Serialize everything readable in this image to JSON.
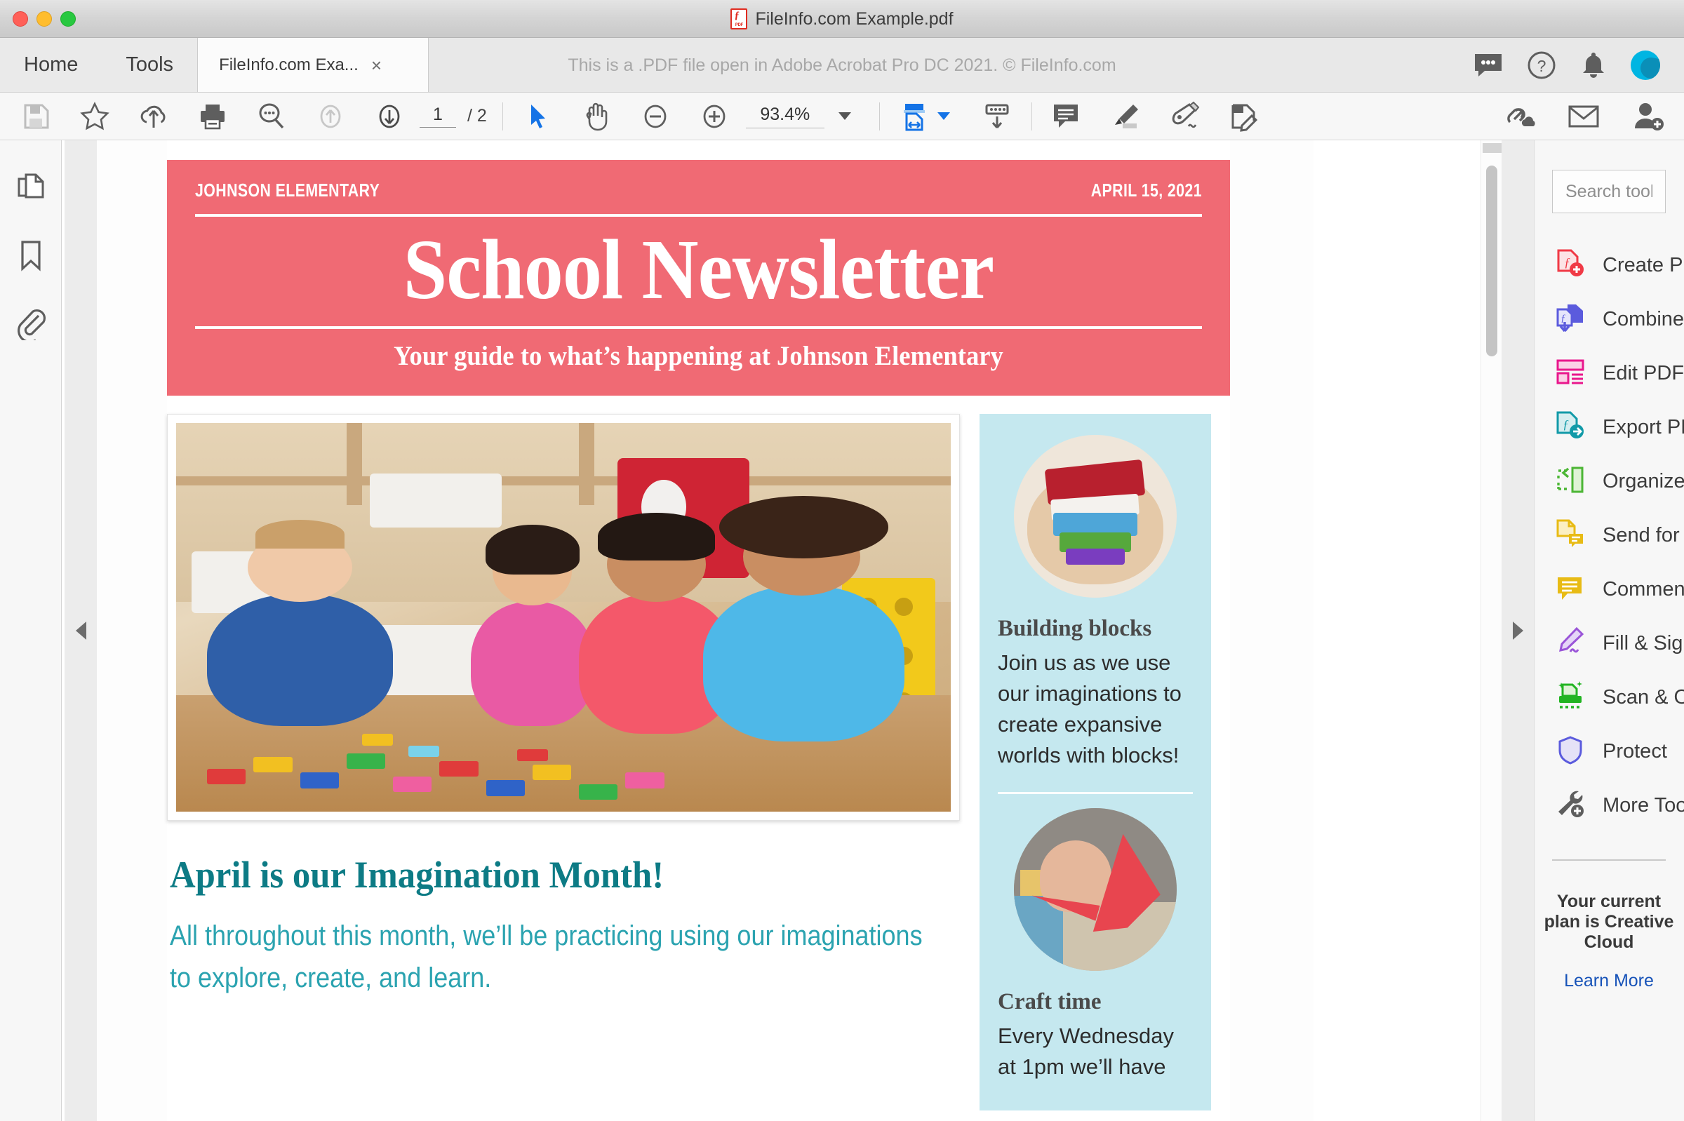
{
  "window": {
    "title": "FileInfo.com Example.pdf",
    "traffic_lights": [
      "close",
      "minimize",
      "zoom"
    ]
  },
  "tabbar": {
    "home_label": "Home",
    "tools_label": "Tools",
    "doc_tab_label": "FileInfo.com Exa...",
    "doc_tab_close": "×",
    "watermark_note": "This is a .PDF file open in Adobe Acrobat Pro DC 2021. © FileInfo.com",
    "right_icons": [
      "chat-icon",
      "help-icon",
      "bell-icon",
      "avatar"
    ]
  },
  "toolbar": {
    "icons_left": [
      "save-icon",
      "star-icon",
      "upload-cloud-icon",
      "print-icon",
      "search-icon",
      "previous-page-icon",
      "next-page-icon"
    ],
    "page_current": "1",
    "page_total": "/ 2",
    "icons_view": [
      "select-tool-icon",
      "hand-tool-icon",
      "zoom-out-icon",
      "zoom-in-icon"
    ],
    "zoom_value": "93.4%",
    "fit_icon": "fit-width-icon",
    "scroll_mode_icon": "scroll-mode-icon",
    "icons_annotate": [
      "comment-icon",
      "highlight-icon",
      "sign-icon",
      "edit-pdf-icon"
    ],
    "icons_right": [
      "share-link-icon",
      "email-icon",
      "add-person-icon"
    ],
    "accent_color": "#1473e6"
  },
  "leftrail": {
    "items": [
      {
        "name": "page-thumbnails-icon"
      },
      {
        "name": "bookmarks-icon"
      },
      {
        "name": "attachments-icon"
      }
    ]
  },
  "tools_panel": {
    "search_placeholder": "Search tools",
    "search_value": "",
    "items": [
      {
        "label": "Create PDF",
        "icon": "create-pdf-icon",
        "color": "#f03a46"
      },
      {
        "label": "Combine Files",
        "icon": "combine-files-icon",
        "color": "#5b5bdd"
      },
      {
        "label": "Edit PDF",
        "icon": "edit-pdf-icon",
        "color": "#e9178c"
      },
      {
        "label": "Export PDF",
        "icon": "export-pdf-icon",
        "color": "#129aa8"
      },
      {
        "label": "Organize Pages",
        "icon": "organize-pages-icon",
        "color": "#4cb635"
      },
      {
        "label": "Send for Comments",
        "icon": "send-for-comments-icon",
        "color": "#e8bb15"
      },
      {
        "label": "Comment",
        "icon": "comment-icon",
        "color": "#e8bb15"
      },
      {
        "label": "Fill & Sign",
        "icon": "fill-and-sign-icon",
        "color": "#9a55d8"
      },
      {
        "label": "Scan & OCR",
        "icon": "scan-ocr-icon",
        "color": "#22b422"
      },
      {
        "label": "Protect",
        "icon": "protect-icon",
        "color": "#5b5bdd"
      },
      {
        "label": "More Tools",
        "icon": "more-tools-icon",
        "color": "#5e5e5e"
      }
    ],
    "plan_text": "Your current plan is Creative Cloud",
    "learn_more_label": "Learn More",
    "learn_more_color": "#1652b8"
  },
  "document": {
    "header": {
      "school": "JOHNSON ELEMENTARY",
      "date": "APRIL 15, 2021",
      "title": "School Newsletter",
      "subtitle": "Your guide to what’s happening at Johnson Elementary",
      "bg_color": "#f06a74"
    },
    "hero_photo_alt": "children-playing-with-blocks-photo",
    "article": {
      "heading": "April is our Imagination Month!",
      "body": "All throughout this month, we’ll be practicing using our imaginations to explore, create, and learn.",
      "heading_color": "#0d7b85",
      "body_color": "#2ba3b0"
    },
    "sidebar": {
      "bg_color": "#c5e8ef",
      "cards": [
        {
          "image_alt": "hands-holding-blocks-photo",
          "heading": "Building blocks",
          "body": "Join us as we use our imaginations to create expansive worlds with blocks!"
        },
        {
          "image_alt": "origami-crane-photo",
          "heading": "Craft time",
          "body": "Every Wednesday at 1pm we’ll have"
        }
      ]
    }
  },
  "scroll": {
    "collapse_left_icon": "collapse-left-arrow",
    "collapse_right_icon": "collapse-right-arrow"
  }
}
